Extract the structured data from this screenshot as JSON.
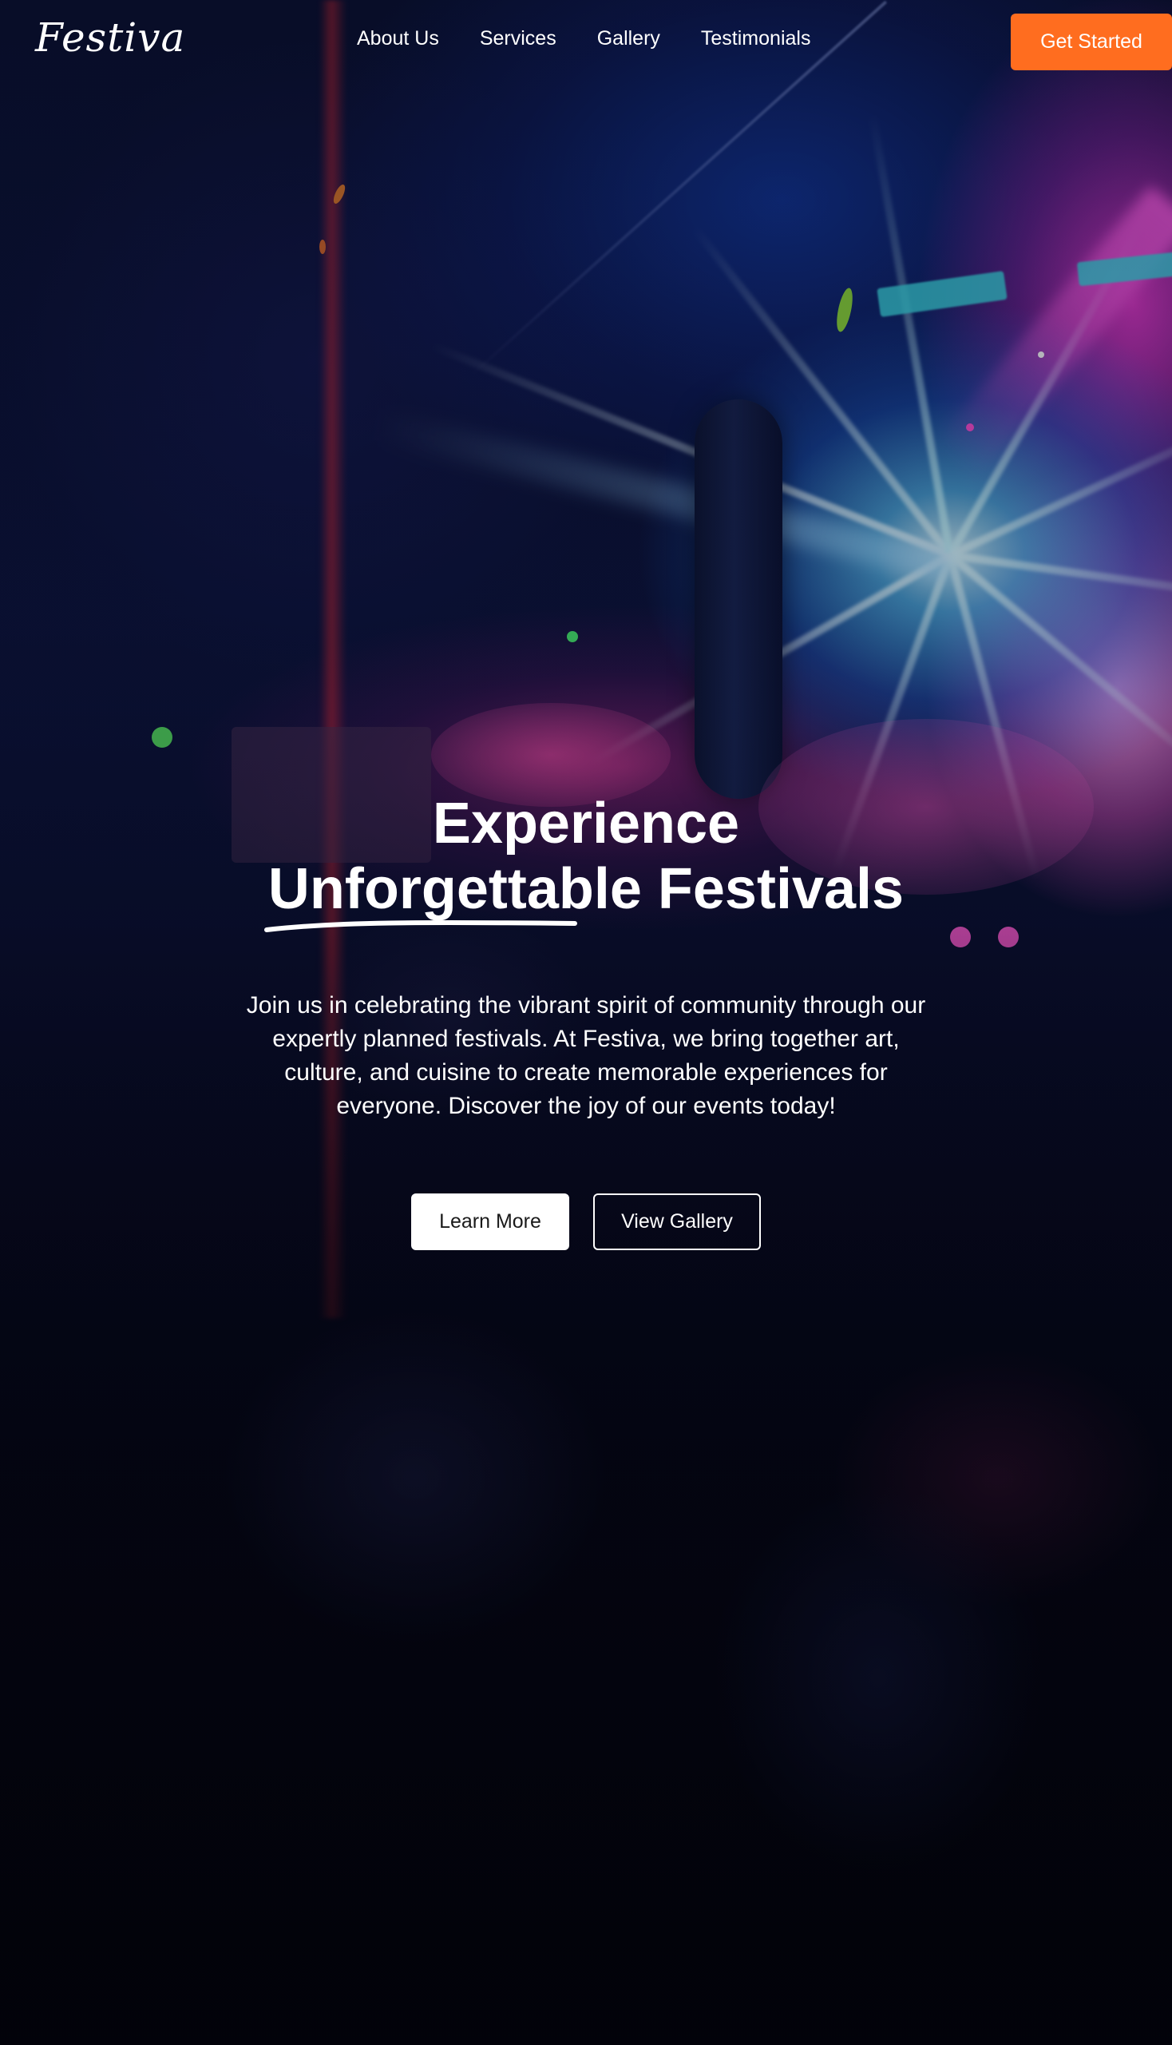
{
  "brand": {
    "logo_text": "Festiva"
  },
  "nav": {
    "links": [
      {
        "label": "About Us"
      },
      {
        "label": "Services"
      },
      {
        "label": "Gallery"
      },
      {
        "label": "Testimonials"
      }
    ],
    "cta_label": "Get Started"
  },
  "hero": {
    "title_line1": "Experience",
    "title_highlight": "Unforgettable",
    "title_rest": " Festivals",
    "subtitle": "Join us in celebrating the vibrant spirit of community through our expertly planned festivals. At Festiva, we bring together art, culture, and cuisine to create memorable experiences for everyone. Discover the joy of our events today!",
    "primary_button": "Learn More",
    "secondary_button": "View Gallery"
  },
  "colors": {
    "accent": "#ff6d1f",
    "text": "#ffffff",
    "primary_button_bg": "#ffffff",
    "primary_button_text": "#1a1a1a",
    "background": "#05060f"
  },
  "background_image": {
    "subject": "festival-crowd-stage-lights-photo"
  }
}
